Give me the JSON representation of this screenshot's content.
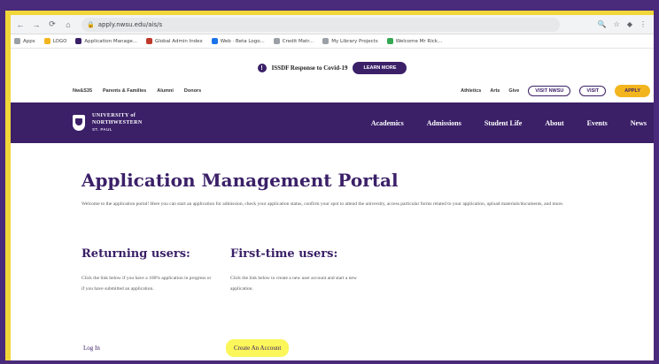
{
  "browser": {
    "url": "apply.nwsu.edu/ais/s",
    "nav_icons": [
      "back-icon",
      "forward-icon",
      "reload-icon",
      "home-icon"
    ],
    "bookmarks": [
      {
        "label": "Apps",
        "color": "#9aa0a6"
      },
      {
        "label": "LOGO",
        "color": "#f3b51e"
      },
      {
        "label": "Application Manage...",
        "color": "#3b2068"
      },
      {
        "label": "Global Admin Index",
        "color": "#c0392b"
      },
      {
        "label": "Web · Beta Logo...",
        "color": "#1a73e8"
      },
      {
        "label": "Credit Matr...",
        "color": "#9aa0a6"
      },
      {
        "label": "My Library Projects",
        "color": "#9aa0a6"
      },
      {
        "label": "Welcome Mr Rick...",
        "color": "#34a853"
      }
    ]
  },
  "alert": {
    "text": "ISSDF Response to Covid-19",
    "button": "LEARN MORE"
  },
  "utility_nav": {
    "left": [
      "Nw&S35",
      "Parents & Families",
      "Alumni",
      "Donors"
    ],
    "right_links": [
      "Athletics",
      "Arts",
      "Give"
    ],
    "buttons": [
      "VISIT NWSU",
      "VISIT",
      "APPLY"
    ]
  },
  "site": {
    "logo_line1": "UNIVERSITY of",
    "logo_line2": "NORTHWESTERN",
    "logo_sub": "ST. PAUL",
    "nav": [
      "Academics",
      "Admissions",
      "Student Life",
      "About",
      "Events",
      "News"
    ]
  },
  "main": {
    "title": "Application Management Portal",
    "intro": "Welcome to the application portal! Here you can start an application for admission, check your application status, confirm your spot to attend the university, access particular forms related to your application, upload materials/documents, and more.",
    "returning": {
      "heading": "Returning users:",
      "text": "Click the link below if you have a 100% application in progress or if you have submitted an application.",
      "link": "Log In"
    },
    "first_time": {
      "heading": "First-time users:",
      "text": "Click the link below to create a new user account and start a new application.",
      "link": "Create An Account"
    }
  }
}
